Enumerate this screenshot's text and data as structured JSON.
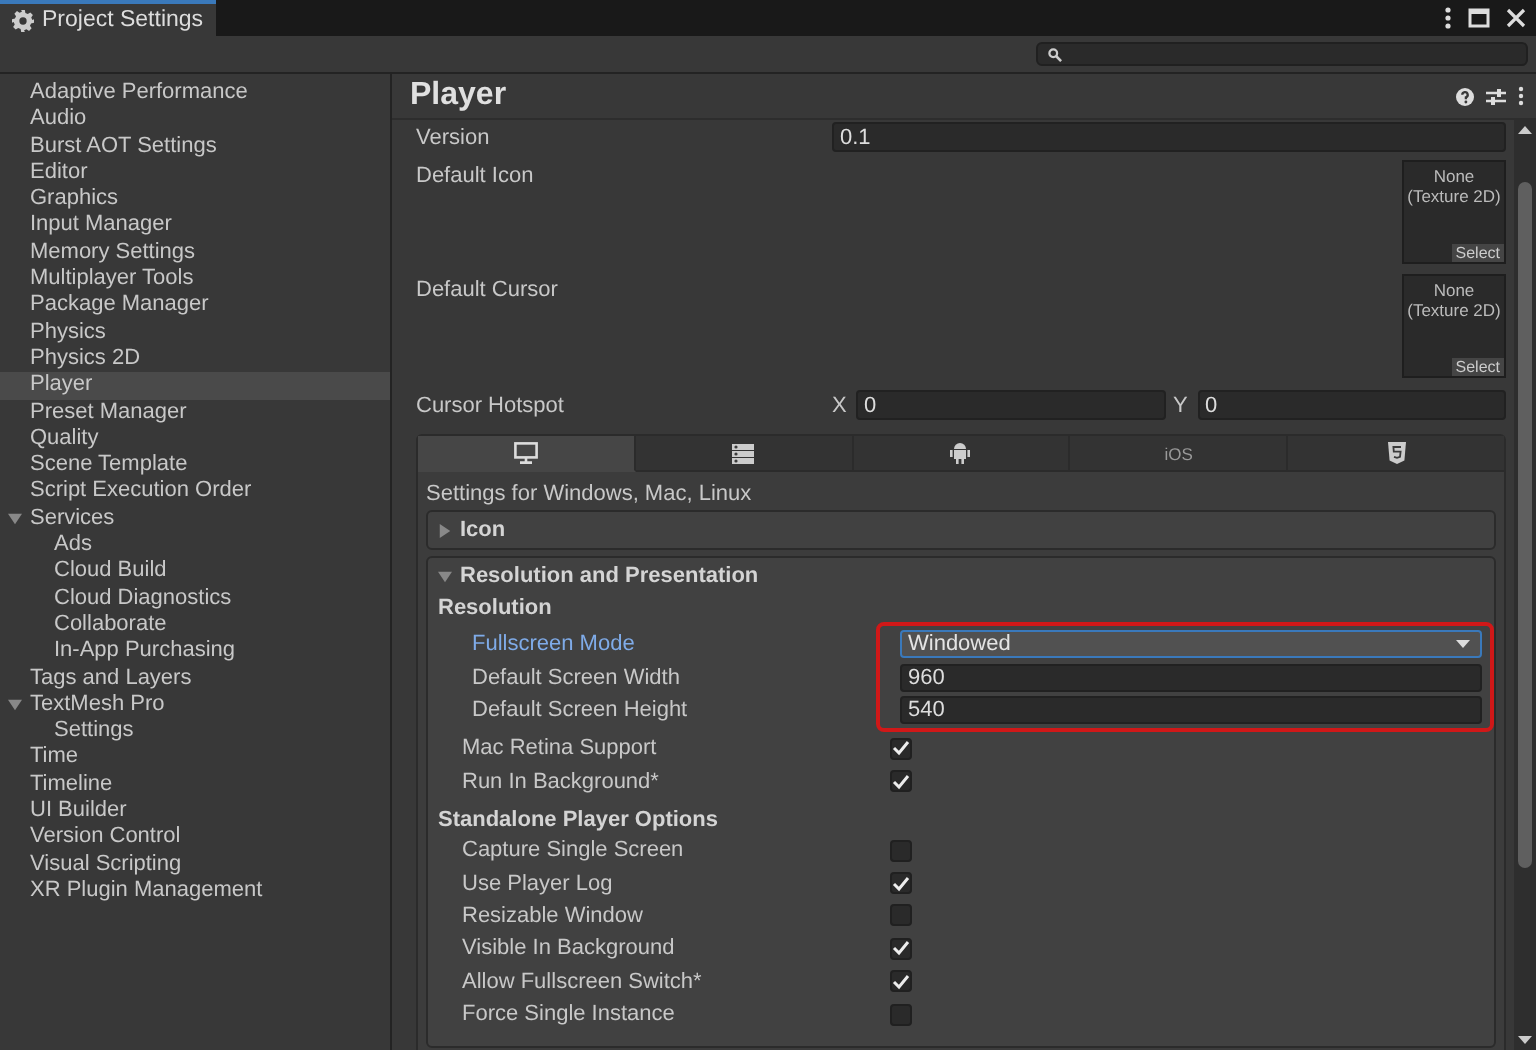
{
  "window": {
    "title": "Project Settings"
  },
  "sidebar": {
    "items": [
      {
        "label": "Adaptive Performance",
        "selected": false
      },
      {
        "label": "Audio",
        "selected": false
      },
      {
        "label": "Burst AOT Settings",
        "selected": false
      },
      {
        "label": "Editor",
        "selected": false
      },
      {
        "label": "Graphics",
        "selected": false
      },
      {
        "label": "Input Manager",
        "selected": false
      },
      {
        "label": "Memory Settings",
        "selected": false
      },
      {
        "label": "Multiplayer Tools",
        "selected": false
      },
      {
        "label": "Package Manager",
        "selected": false
      },
      {
        "label": "Physics",
        "selected": false
      },
      {
        "label": "Physics 2D",
        "selected": false
      },
      {
        "label": "Player",
        "selected": true
      },
      {
        "label": "Preset Manager",
        "selected": false
      },
      {
        "label": "Quality",
        "selected": false
      },
      {
        "label": "Scene Template",
        "selected": false
      },
      {
        "label": "Script Execution Order",
        "selected": false
      },
      {
        "label": "Services",
        "selected": false,
        "expanded": true,
        "children": [
          {
            "label": "Ads",
            "selected": false
          },
          {
            "label": "Cloud Build",
            "selected": false
          },
          {
            "label": "Cloud Diagnostics",
            "selected": false
          },
          {
            "label": "Collaborate",
            "selected": false
          },
          {
            "label": "In-App Purchasing",
            "selected": false
          }
        ]
      },
      {
        "label": "Tags and Layers",
        "selected": false
      },
      {
        "label": "TextMesh Pro",
        "selected": false,
        "expanded": true,
        "children": [
          {
            "label": "Settings",
            "selected": false
          }
        ]
      },
      {
        "label": "Time",
        "selected": false
      },
      {
        "label": "Timeline",
        "selected": false
      },
      {
        "label": "UI Builder",
        "selected": false
      },
      {
        "label": "Version Control",
        "selected": false
      },
      {
        "label": "Visual Scripting",
        "selected": false
      },
      {
        "label": "XR Plugin Management",
        "selected": false
      }
    ]
  },
  "content": {
    "title": "Player",
    "version": {
      "label": "Version",
      "value": "0.1"
    },
    "object_fields": [
      {
        "label": "Default Icon",
        "value": "None\n(Texture 2D)",
        "button": "Select"
      },
      {
        "label": "Default Cursor",
        "value": "None\n(Texture 2D)",
        "button": "Select"
      }
    ],
    "cursor_hotspot": {
      "label": "Cursor Hotspot",
      "x_label": "X",
      "x_value": "0",
      "y_label": "Y",
      "y_value": "0"
    },
    "platform_tabs": [
      {
        "kind": "icon",
        "selected": true
      },
      {
        "kind": "icon",
        "selected": false
      },
      {
        "kind": "icon",
        "selected": false
      },
      {
        "kind": "text",
        "label": "iOS",
        "selected": false
      },
      {
        "kind": "icon",
        "selected": false
      }
    ],
    "platform_caption": "Settings for Windows, Mac, Linux",
    "sections": [
      {
        "title": "Icon",
        "expanded": false
      },
      {
        "title": "Resolution and Presentation",
        "expanded": true
      }
    ],
    "groups": [
      {
        "title": "Resolution",
        "outlined_rows": [
          {
            "kind": "dropdown",
            "label": "Fullscreen Mode",
            "value": "Windowed",
            "focused": true
          },
          {
            "kind": "number",
            "label": "Default Screen Width",
            "value": "960",
            "focused": false
          },
          {
            "kind": "number",
            "label": "Default Screen Height",
            "value": "540",
            "focused": false
          }
        ],
        "rows": [
          {
            "kind": "checkbox",
            "label": "Mac Retina Support",
            "checked": true
          },
          {
            "kind": "checkbox",
            "label": "Run In Background*",
            "checked": true
          }
        ]
      },
      {
        "title": "Standalone Player Options",
        "rows": [
          {
            "kind": "checkbox",
            "label": "Capture Single Screen",
            "checked": false
          },
          {
            "kind": "checkbox",
            "label": "Use Player Log",
            "checked": true
          },
          {
            "kind": "checkbox",
            "label": "Resizable Window",
            "checked": false
          },
          {
            "kind": "checkbox",
            "label": "Visible In Background",
            "checked": true
          },
          {
            "kind": "checkbox",
            "label": "Allow Fullscreen Switch*",
            "checked": true
          },
          {
            "kind": "checkbox",
            "label": "Force Single Instance",
            "checked": false
          }
        ]
      }
    ]
  }
}
